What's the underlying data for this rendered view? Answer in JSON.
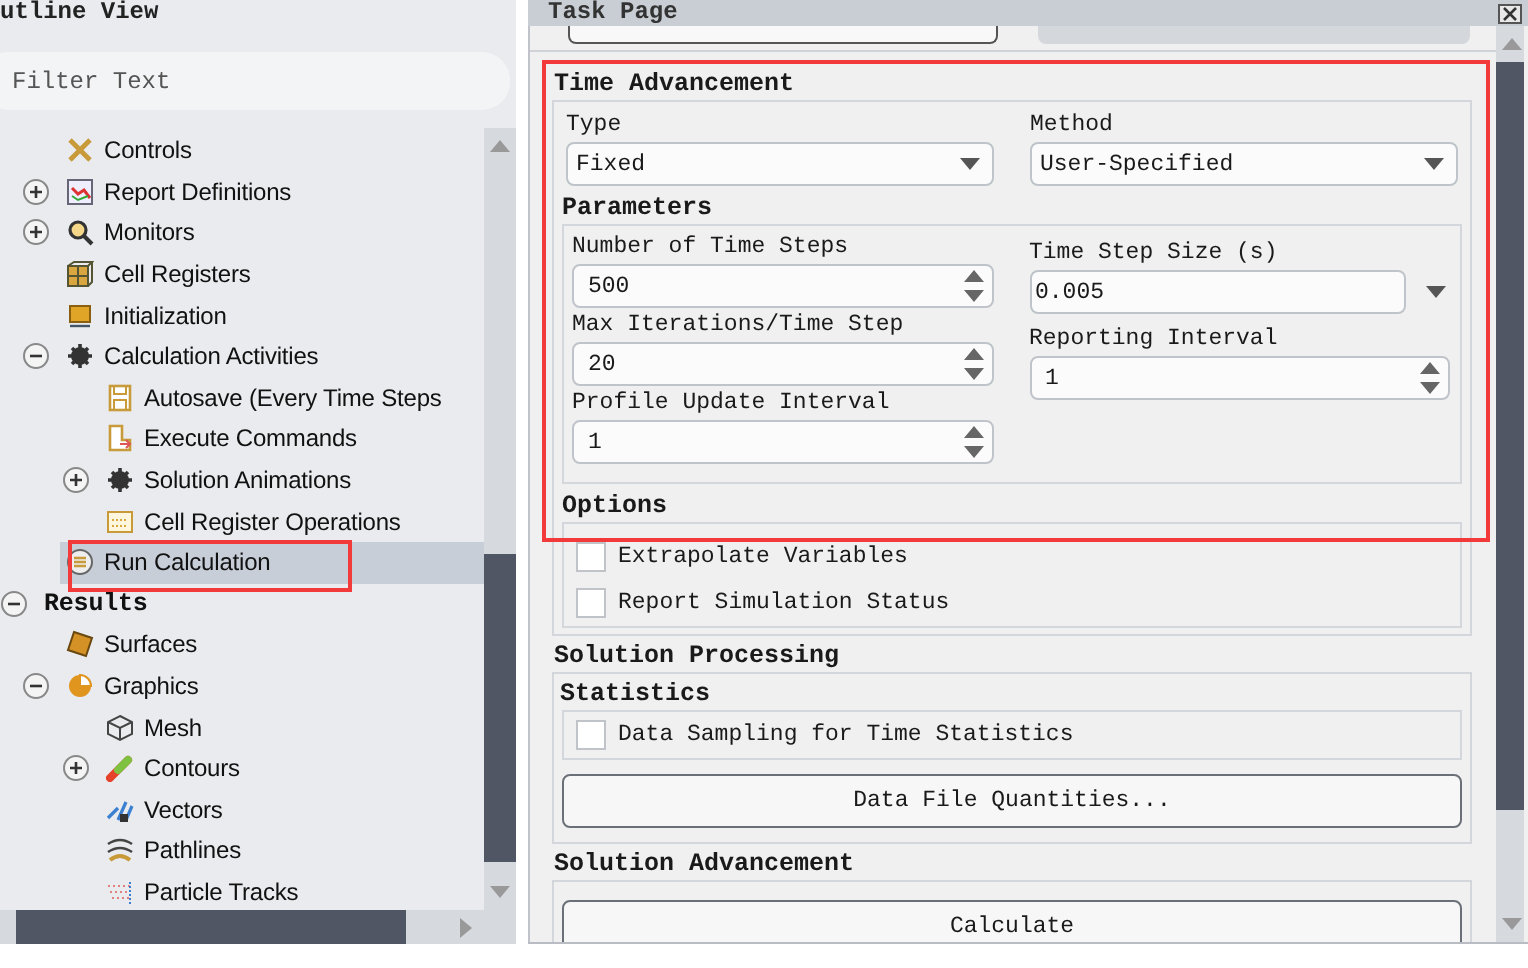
{
  "outline_view": {
    "title": "utline View",
    "filter": {
      "placeholder": "Filter Text"
    }
  },
  "tree": {
    "items": [
      {
        "label": "Controls",
        "selected": false
      },
      {
        "label": "Report Definitions",
        "expanded": false,
        "selected": false
      },
      {
        "label": "Monitors",
        "expanded": false,
        "selected": false
      },
      {
        "label": "Cell Registers",
        "selected": false
      },
      {
        "label": "Initialization",
        "selected": false
      },
      {
        "label": "Calculation Activities",
        "expanded": true,
        "selected": false,
        "children": [
          {
            "label": "Autosave (Every Time Steps",
            "selected": false
          },
          {
            "label": "Execute Commands",
            "selected": false
          },
          {
            "label": "Solution Animations",
            "expanded": false,
            "selected": false
          },
          {
            "label": "Cell Register Operations",
            "selected": false
          }
        ]
      },
      {
        "label": "Run Calculation",
        "selected": true
      }
    ]
  },
  "results": {
    "label": "Results",
    "expanded": true,
    "selected": false,
    "children": [
      {
        "label": "Surfaces",
        "selected": false
      },
      {
        "label": "Graphics",
        "expanded": true,
        "selected": false,
        "children": [
          {
            "label": "Mesh",
            "selected": false
          },
          {
            "label": "Contours",
            "expanded": false,
            "selected": false
          },
          {
            "label": "Vectors",
            "selected": false
          },
          {
            "label": "Pathlines",
            "selected": false
          },
          {
            "label": "Particle Tracks",
            "selected": false
          }
        ]
      }
    ]
  },
  "task_page": {
    "title": "Task Page"
  },
  "time_advancement": {
    "heading": "Time Advancement",
    "type": {
      "label": "Type",
      "value": "Fixed"
    },
    "method": {
      "label": "Method",
      "value": "User-Specified"
    }
  },
  "parameters": {
    "heading": "Parameters",
    "left_fields": [
      {
        "label": "Number of Time Steps",
        "value": "500",
        "kind": "spinner"
      },
      {
        "label": "Max Iterations/Time Step",
        "value": "20",
        "kind": "spinner"
      },
      {
        "label": "Profile Update Interval",
        "value": "1",
        "kind": "spinner"
      }
    ],
    "right_fields": [
      {
        "label": "Time Step Size (s)",
        "value": "0.005",
        "kind": "dropdown"
      },
      {
        "label": "Reporting Interval",
        "value": "1",
        "kind": "spinner"
      }
    ]
  },
  "options": {
    "heading": "Options",
    "items": [
      {
        "label": "Extrapolate Variables",
        "checked": false
      },
      {
        "label": "Report Simulation Status",
        "checked": false
      }
    ]
  },
  "solution_processing": {
    "heading": "Solution Processing",
    "statistics": {
      "heading": "Statistics",
      "items": [
        {
          "label": "Data Sampling for Time Statistics",
          "checked": false
        }
      ]
    },
    "button": "Data File Quantities..."
  },
  "solution_advancement": {
    "heading": "Solution Advancement",
    "button": "Calculate"
  }
}
